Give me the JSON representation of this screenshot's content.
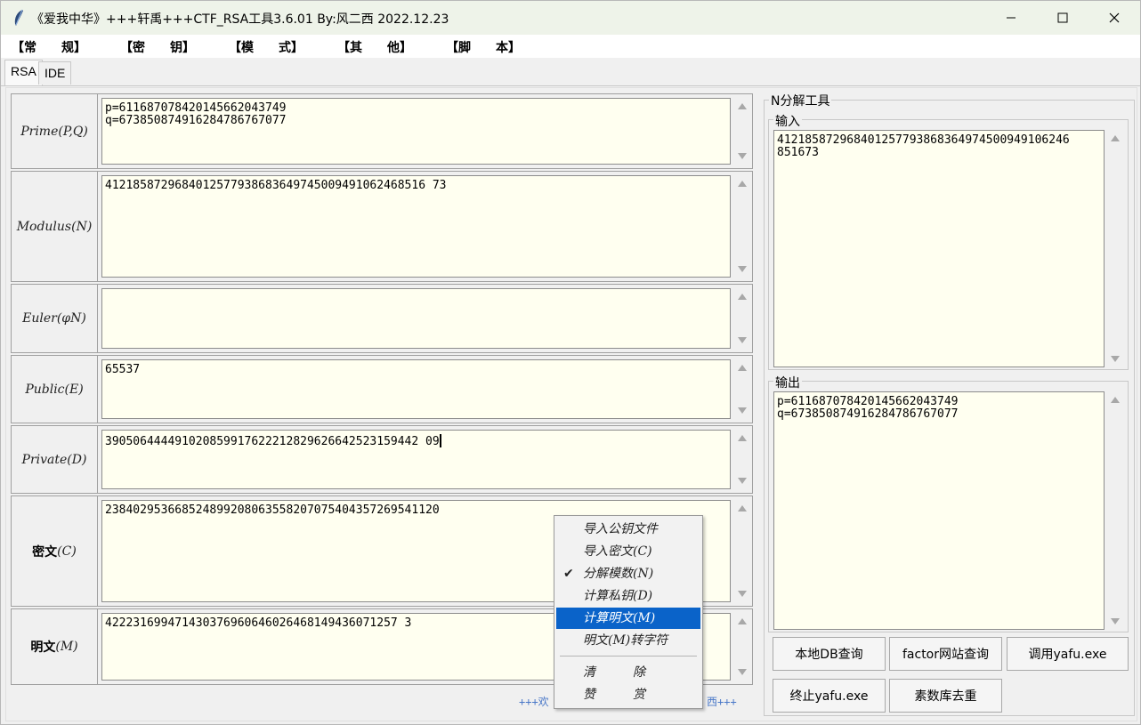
{
  "window": {
    "title": "《爱我中华》+++轩禹+++CTF_RSA工具3.6.01   By:风二西 2022.12.23"
  },
  "menu": [
    "【常　　规】",
    "【密　　钥】",
    "【模　　式】",
    "【其　　他】",
    "【脚　　本】"
  ],
  "tabs": [
    "RSA",
    "IDE"
  ],
  "fields": {
    "prime": {
      "label": "Prime(P,Q)",
      "value": "p=611687078420145662043749\nq=673850874916284786767077"
    },
    "modulus": {
      "label": "Modulus(N)",
      "value": "4121858729684012577938683649745009491062468516 73"
    },
    "euler": {
      "label": "Euler(φN)",
      "value": ""
    },
    "public": {
      "label": "Public(E)",
      "value": "65537"
    },
    "private": {
      "label": "Private(D)",
      "value": "390506444491020859917622212829626642523159442 09"
    },
    "cipher": {
      "label_cn": "密文",
      "label_en": "(C)",
      "value": "238402953668524899208063558207075404357269541120"
    },
    "plain": {
      "label_cn": "明文",
      "label_en": "(M)",
      "value": "422231699471430376960646026468149436071257 3"
    }
  },
  "status": {
    "left": "+++欢",
    "right": "西+++"
  },
  "nfactor": {
    "title": "N分解工具",
    "input_label": "输入",
    "input_value": "412185872968401257793868364974500949106246\n851673",
    "output_label": "输出",
    "output_value": "p=611687078420145662043749\nq=673850874916284786767077",
    "buttons": [
      "本地DB查询",
      "factor网站查询",
      "调用yafu.exe",
      "终止yafu.exe",
      "素数库去重"
    ]
  },
  "context_menu": {
    "items": [
      "导入公钥文件",
      "导入密文(C)",
      "分解模数(N)",
      "计算私钥(D)",
      "计算明文(M)",
      "明文(M)转字符"
    ],
    "extra": [
      "清　　　除",
      "赞　　　赏"
    ],
    "checked": "分解模数(N)",
    "highlighted": "计算明文(M)"
  }
}
